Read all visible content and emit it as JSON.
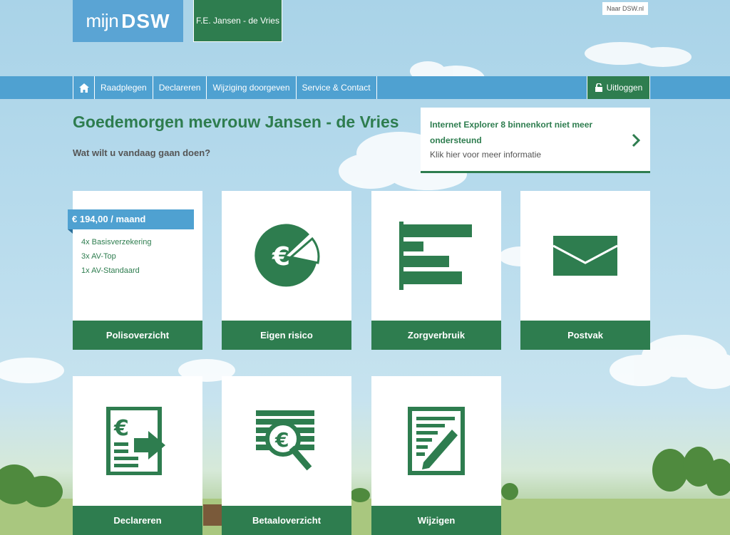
{
  "header": {
    "logo_prefix": "mijn",
    "logo_brand": "DSW",
    "user_name": "F.E. Jansen - de Vries",
    "external_link": "Naar DSW.nl"
  },
  "nav": {
    "home_icon": "home-icon",
    "items": [
      "Raadplegen",
      "Declareren",
      "Wijziging doorgeven",
      "Service & Contact"
    ],
    "logout_label": "Uitloggen",
    "logout_icon": "unlock-icon"
  },
  "greeting": {
    "title": "Goedemorgen mevrouw Jansen - de Vries",
    "subtitle": "Wat wilt u vandaag gaan doen?"
  },
  "notice": {
    "title": "Internet Explorer 8 binnenkort niet meer ondersteund",
    "subtitle": "Klik hier voor meer informatie",
    "icon": "chevron-right-icon"
  },
  "tiles": {
    "policy": {
      "price": "€ 194,00 / maand",
      "items": [
        "4x Basisverzekering",
        "3x AV-Top",
        "1x AV-Standaard"
      ],
      "label": "Polisoverzicht"
    },
    "risk": {
      "label": "Eigen risico",
      "icon": "euro-pie-icon"
    },
    "usage": {
      "label": "Zorgverbruik",
      "icon": "bar-chart-icon"
    },
    "mail": {
      "label": "Postvak",
      "icon": "envelope-icon"
    },
    "claim": {
      "label": "Declareren",
      "icon": "euro-document-arrow-icon"
    },
    "payments": {
      "label": "Betaaloverzicht",
      "icon": "euro-magnifier-icon"
    },
    "change": {
      "label": "Wijzigen",
      "icon": "document-pencil-icon"
    }
  },
  "colors": {
    "brand_green": "#2e7d4f",
    "brand_blue": "#4fa1d1"
  }
}
